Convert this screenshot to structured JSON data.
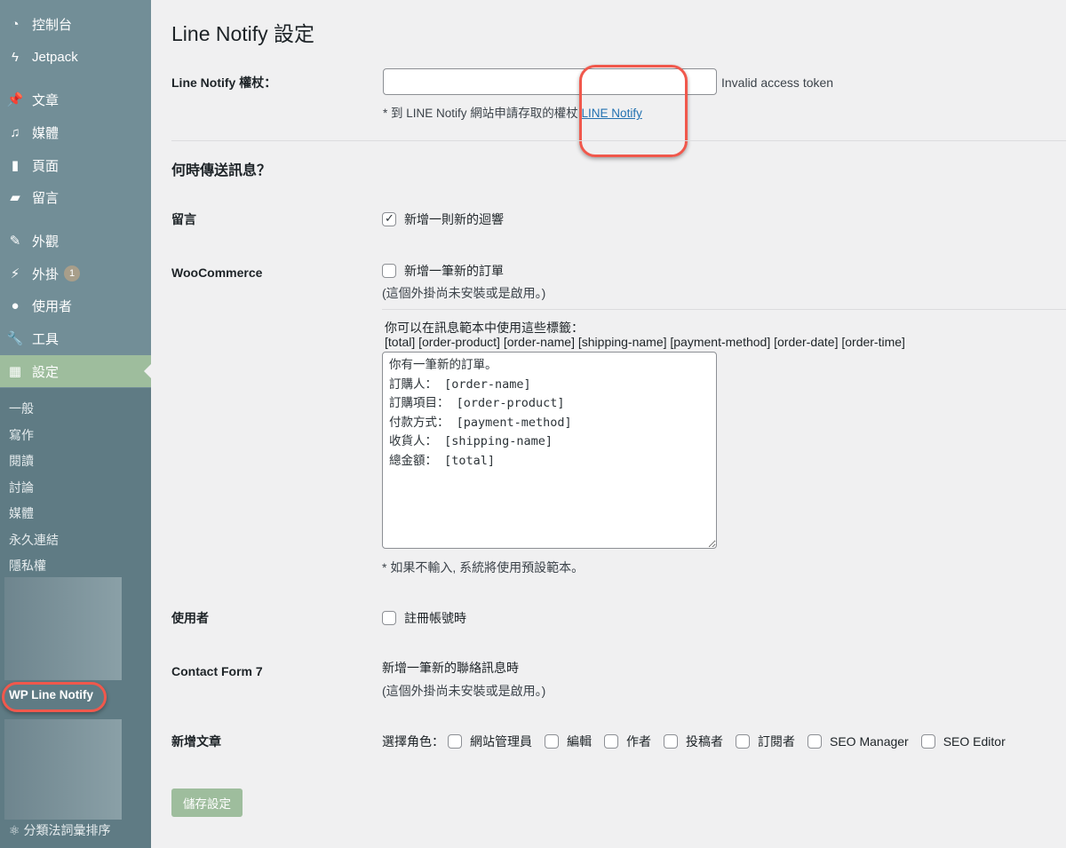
{
  "sidebar": {
    "items": [
      {
        "label": "控制台",
        "icon": "dashboard-icon"
      },
      {
        "label": "Jetpack",
        "icon": "jetpack-icon"
      },
      {
        "label": "文章",
        "icon": "pin-icon"
      },
      {
        "label": "媒體",
        "icon": "media-icon"
      },
      {
        "label": "頁面",
        "icon": "pages-icon"
      },
      {
        "label": "留言",
        "icon": "comment-icon"
      },
      {
        "label": "外觀",
        "icon": "appearance-icon"
      },
      {
        "label": "外掛",
        "icon": "plugin-icon",
        "badge": "1"
      },
      {
        "label": "使用者",
        "icon": "user-icon"
      },
      {
        "label": "工具",
        "icon": "wrench-icon"
      },
      {
        "label": "設定",
        "icon": "settings-icon",
        "active": true
      }
    ],
    "submenu": [
      "一般",
      "寫作",
      "閱讀",
      "討論",
      "媒體",
      "永久連結",
      "隱私權"
    ],
    "wp_line_notify": "WP Line Notify",
    "taxonomy_order": "分類法詞彙排序"
  },
  "page": {
    "title": "Line Notify 設定",
    "token": {
      "label": "Line Notify 權杖：",
      "value": "",
      "status": "Invalid access token",
      "help": "* 到 LINE Notify 網站申請存取的權杖",
      "link": "LINE Notify"
    },
    "when_heading": "何時傳送訊息？",
    "comment": {
      "label": "留言",
      "option": "新增一則新的迴響",
      "checked": true
    },
    "woo": {
      "label": "WooCommerce",
      "option": "新增一筆新的訂單",
      "checked": false,
      "note": "(這個外掛尚未安裝或是啟用。)",
      "tags_intro": "你可以在訊息範本中使用這些標籤：",
      "tags": "[total] [order-product] [order-name] [shipping-name] [payment-method] [order-date] [order-time]",
      "template": "你有一筆新的訂單。\n訂購人： [order-name]\n訂購項目： [order-product]\n付款方式： [payment-method]\n收貨人： [shipping-name]\n總金額： [total]",
      "template_note": "* 如果不輸入, 系統將使用預設範本。"
    },
    "users": {
      "label": "使用者",
      "option": "註冊帳號時",
      "checked": false
    },
    "cf7": {
      "label": "Contact Form 7",
      "text": "新增一筆新的聯絡訊息時",
      "note": "(這個外掛尚未安裝或是啟用。)"
    },
    "new_post": {
      "label": "新增文章",
      "roles_label": "選擇角色：",
      "roles": [
        "網站管理員",
        "編輯",
        "作者",
        "投稿者",
        "訂閱者",
        "SEO Manager",
        "SEO Editor"
      ]
    },
    "save": "儲存設定"
  },
  "colors": {
    "sidebar": "#728e97",
    "submenu": "#5f7b84",
    "active": "#9ebd9d",
    "highlight": "#f0584c",
    "link": "#2271b1",
    "button": "#9ebd9d"
  }
}
